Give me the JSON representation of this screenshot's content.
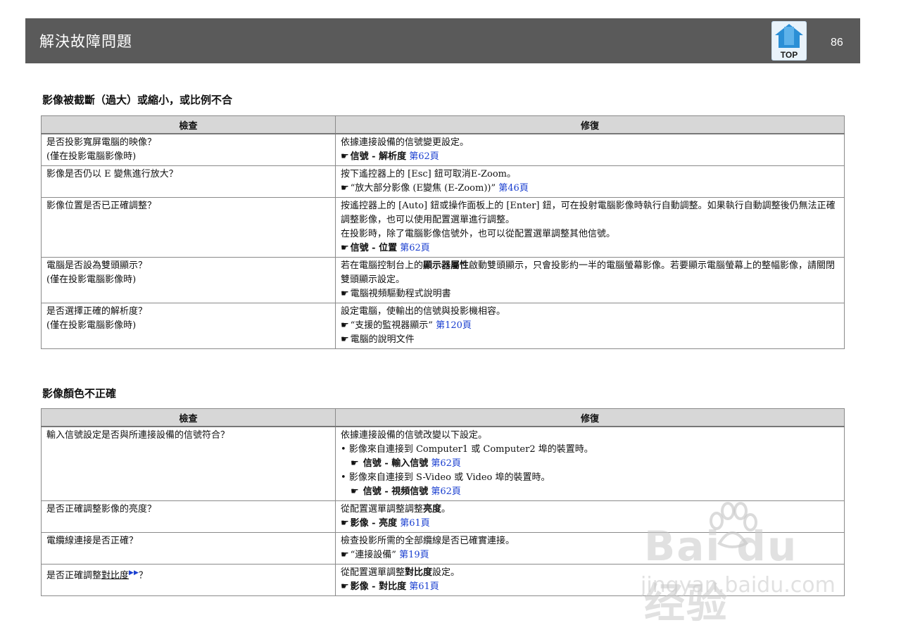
{
  "header": {
    "title": "解決故障問題",
    "page_number": "86",
    "top_icon_label": "TOP"
  },
  "section1": {
    "title": "影像被截斷（過大）或縮小，或比例不合",
    "col_check": "檢查",
    "col_fix": "修復",
    "rows": [
      {
        "check": [
          "是否投影寬屏電腦的映像？",
          "(僅在投影電腦影像時)"
        ],
        "fix_text": "依據連接設備的信號變更設定。",
        "ref_label": "信號 - 解析度",
        "ref_link": "第62頁"
      },
      {
        "check": [
          "影像是否仍以 E 變焦進行放大？"
        ],
        "fix_text": "按下遙控器上的 [Esc] 鈕可取消E-Zoom。",
        "ref_label": "“放大部分影像 (E變焦 (E-Zoom))”",
        "ref_link": "第46頁"
      },
      {
        "check": [
          "影像位置是否已正確調整？"
        ],
        "fix_text": "按遙控器上的 [Auto] 鈕或操作面板上的 [Enter] 鈕，可在投射電腦影像時執行自動調整。如果執行自動調整後仍無法正確調整影像，也可以使用配置選單進行調整。",
        "fix_text2": "在投影時，除了電腦影像信號外，也可以從配置選單調整其他信號。",
        "ref_label": "信號 - 位置",
        "ref_link": "第62頁"
      },
      {
        "check": [
          "電腦是否設為雙頭顯示？",
          "(僅在投影電腦影像時)"
        ],
        "fix_pre": "若在電腦控制台上的",
        "fix_bold": "顯示器屬性",
        "fix_post": "啟動雙頭顯示，只會投影約一半的電腦螢幕影像。若要顯示電腦螢幕上的整幅影像，請關閉雙頭顯示設定。",
        "ref_label": "電腦視頻驅動程式說明書"
      },
      {
        "check": [
          "是否選擇正確的解析度？",
          "(僅在投影電腦影像時)"
        ],
        "fix_text": "設定電腦，使輸出的信號與投影機相容。",
        "ref_label": "“支援的監視器顯示”",
        "ref_link": "第120頁",
        "ref2_label": "電腦的說明文件"
      }
    ]
  },
  "section2": {
    "title": "影像顏色不正確",
    "col_check": "檢查",
    "col_fix": "修復",
    "rows": [
      {
        "check": "輸入信號設定是否與所連接設備的信號符合？",
        "fix_text": "依據連接設備的信號改變以下設定。",
        "bullet1": "影像來自連接到 Computer1 或 Computer2 埠的裝置時。",
        "bullet1_ref_label": "信號 - 輸入信號",
        "bullet1_ref_link": "第62頁",
        "bullet2": "影像來自連接到 S-Video 或 Video 埠的裝置時。",
        "bullet2_ref_label": "信號 - 視頻信號",
        "bullet2_ref_link": "第62頁"
      },
      {
        "check": "是否正確調整影像的亮度？",
        "fix_pre": "從配置選單調整調整",
        "fix_bold": "亮度",
        "fix_post": "。",
        "ref_label": "影像 - 亮度",
        "ref_link": "第61頁"
      },
      {
        "check": "電纜線連接是否正確？",
        "fix_text": "檢查投影所需的全部纜線是否已確實連接。",
        "ref_label": "“連接設備”",
        "ref_link": "第19頁"
      },
      {
        "check_pre": "是否正確調整",
        "check_ul": "對比度",
        "check_post": "？",
        "fix_pre": "從配置選單調整",
        "fix_bold": "對比度",
        "fix_post": "設定。",
        "ref_label": "影像 - 對比度",
        "ref_link": "第61頁"
      }
    ]
  },
  "watermark": {
    "brand": "Bai du 经验",
    "url": "jingyan.baidu.com"
  }
}
